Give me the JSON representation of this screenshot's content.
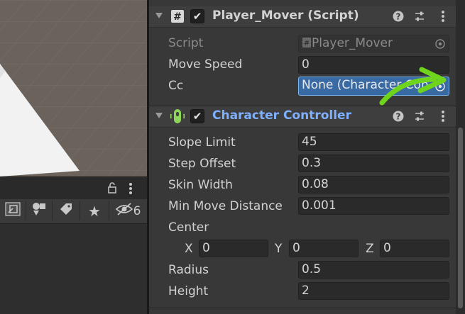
{
  "project_toolbar": {
    "hidden_count": "6",
    "icons": [
      "lock-icon",
      "more-vert-icon",
      "folder-link-icon",
      "shapes-icon",
      "tag-icon",
      "star-icon",
      "eye-off-icon"
    ]
  },
  "player_mover": {
    "title": "Player_Mover (Script)",
    "enabled": true,
    "script_label": "Script",
    "script_value": "Player_Mover",
    "move_speed_label": "Move Speed",
    "move_speed_value": "0",
    "cc_label": "Cc",
    "cc_value": "None (Character Con"
  },
  "character_controller": {
    "title": "Character Controller",
    "enabled": true,
    "fields": {
      "slope_limit": {
        "label": "Slope Limit",
        "value": "45"
      },
      "step_offset": {
        "label": "Step Offset",
        "value": "0.3"
      },
      "skin_width": {
        "label": "Skin Width",
        "value": "0.08"
      },
      "min_move_distance": {
        "label": "Min Move Distance",
        "value": "0.001"
      },
      "radius": {
        "label": "Radius",
        "value": "0.5"
      },
      "height": {
        "label": "Height",
        "value": "2"
      }
    },
    "center": {
      "label": "Center",
      "x_label": "X",
      "x_value": "0",
      "y_label": "Y",
      "y_value": "0",
      "z_label": "Z",
      "z_value": "0"
    }
  },
  "colors": {
    "link_title": "#7fb0ff",
    "annotation_arrow": "#6fd41c",
    "selected_field": "#3a6aa4"
  }
}
